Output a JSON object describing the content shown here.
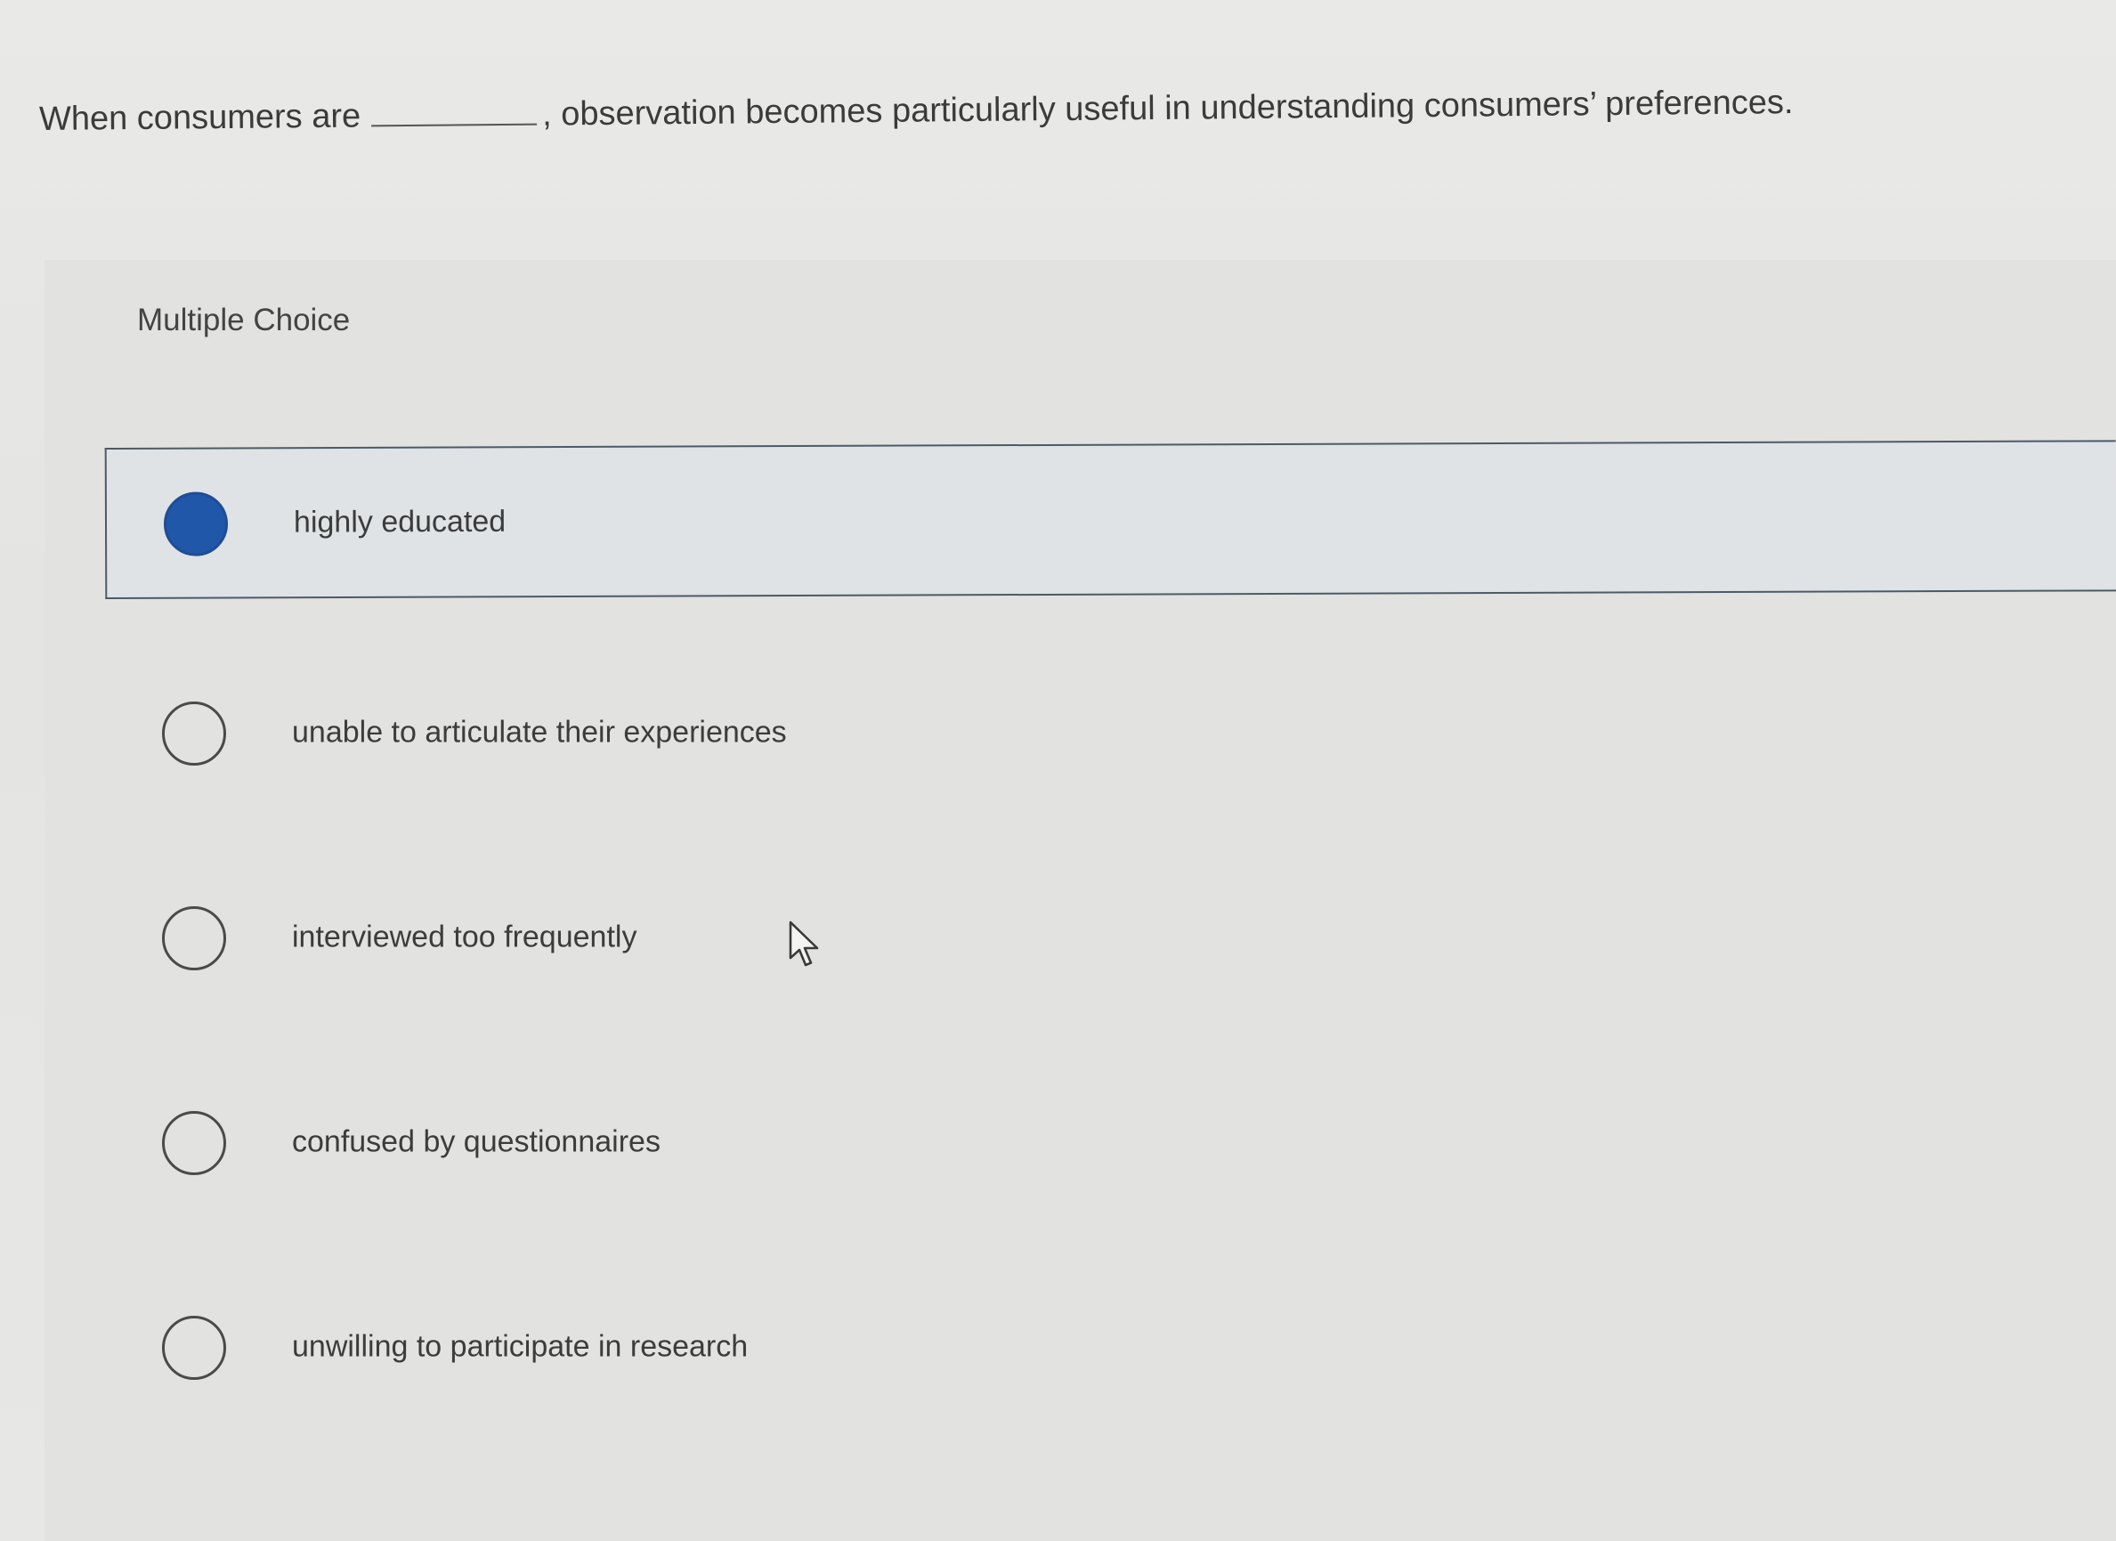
{
  "question": {
    "before_blank": "When consumers are",
    "after_blank": ", observation becomes particularly useful in understanding consumers’ preferences."
  },
  "question_type": "Multiple Choice",
  "options": [
    {
      "label": "highly educated",
      "selected": true
    },
    {
      "label": "unable to articulate their experiences",
      "selected": false
    },
    {
      "label": "interviewed too frequently",
      "selected": false
    },
    {
      "label": "confused by questionnaires",
      "selected": false
    },
    {
      "label": "unwilling to participate in research",
      "selected": false
    }
  ],
  "colors": {
    "selected_radio": "#2157a8",
    "selected_border": "#4d5a66",
    "text": "#3a3a3a"
  },
  "icons": {
    "cursor": "mouse-pointer-icon"
  }
}
